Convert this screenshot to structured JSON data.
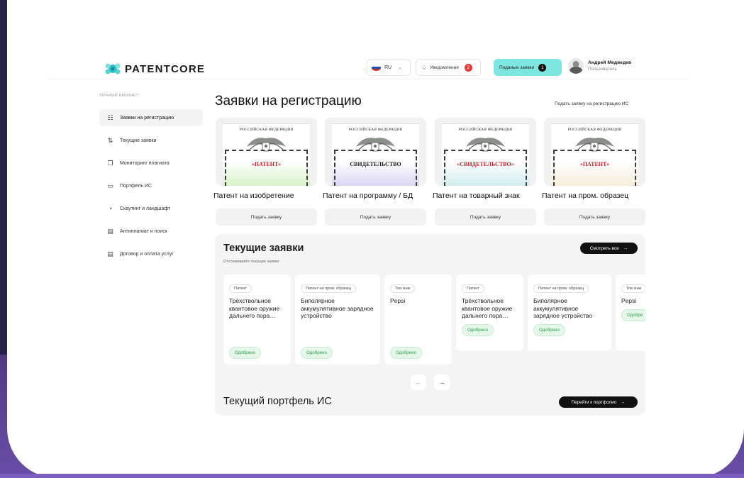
{
  "brand": {
    "name": "PATENTCORE"
  },
  "header": {
    "lang": "RU",
    "notifications_label": "Уведомления",
    "notifications_count": "2",
    "submitted_label": "Поданые заявки",
    "submitted_count": "1",
    "user_name": "Андрей Медведев",
    "user_role": "Пользователь",
    "flag_colors": [
      "#ffffff",
      "#1f4fb8",
      "#d52b1e"
    ]
  },
  "sidebar": {
    "section_title": "ЛИЧНЫЙ КАБИНЕТ",
    "items": [
      {
        "label": "Заявки на регистрацию",
        "icon": "registration-icon",
        "glyph": "☷"
      },
      {
        "label": "Текущие заявки",
        "icon": "flow-icon",
        "glyph": "⇅"
      },
      {
        "label": "Мониторинг плагиата",
        "icon": "copy-icon",
        "glyph": "❐"
      },
      {
        "label": "Портфель ИС",
        "icon": "briefcase-icon",
        "glyph": "▭"
      },
      {
        "label": "Скаутинг и ландшафт",
        "icon": "stopwatch-icon",
        "glyph": "◔"
      },
      {
        "label": "Антиплагиат и поиск",
        "icon": "doc-search-icon",
        "glyph": "▤"
      },
      {
        "label": "Договор и оплата услуг",
        "icon": "contract-icon",
        "glyph": "▤"
      }
    ]
  },
  "main": {
    "title": "Заявки на регистрацию",
    "register_link": "Подать заявку на регистрацию ИС",
    "certificates": [
      {
        "header": "РОССИЙСКАЯ ФЕДЕРАЦИЯ",
        "doc": "«ПАТЕНТ»",
        "label": "Патент на изобретение",
        "button": "Подать заявку",
        "tint": "#d9f2c9",
        "ink": "#c21f2a"
      },
      {
        "header": "РОССИЙСКАЯ ФЕДЕРАЦИЯ",
        "doc": "СВИДЕТЕЛЬСТВО",
        "label": "Патент на программу / БД",
        "button": "Подать заявку",
        "tint": "#dcd6f2",
        "ink": "#1b1b1b"
      },
      {
        "header": "РОССИЙСКАЯ ФЕДЕРАЦИЯ",
        "doc": "«СВИДЕТЕЛЬСТВО»",
        "label": "Патент на товарный знак",
        "button": "Подать заявку",
        "tint": "#d3ecef",
        "ink": "#c21f2a"
      },
      {
        "header": "РОССИЙСКАЯ ФЕДЕРАЦИЯ",
        "doc": "«ПАТЕНТ»",
        "label": "Патент на пром. образец",
        "button": "Подать заявку",
        "tint": "#f6ecd9",
        "ink": "#c21f2a"
      }
    ]
  },
  "current": {
    "title": "Текущие заявки",
    "subtitle": "Отслеживайте текущие заявки",
    "see_all": "Смотреть все",
    "cards": [
      {
        "tag": "Патент",
        "title": "Трёхствольное квантовое оружие дальнего пора…",
        "status": "Одобрено"
      },
      {
        "tag": "Патент на пром. образец",
        "title": "Биполярное аккумулятивное зарядное устройство",
        "status": "Одобрено"
      },
      {
        "tag": "Тов.знак",
        "title": "Pepsi",
        "status": "Одобрено"
      },
      {
        "tag": "Патент",
        "title": "Трёхствольное квантовое оружие дальнего пора…",
        "status": "Одобрено"
      },
      {
        "tag": "Патент на пром. образец",
        "title": "Биполярное аккумулятивное зарядное устройство",
        "status": "Одобрено"
      },
      {
        "tag": "Тов.знак",
        "title": "Pepsi",
        "status": "Одобре"
      }
    ],
    "prev": "←",
    "next": "→"
  },
  "portfolio": {
    "title": "Текущий портфель ИС",
    "button": "Перейти к портфолио"
  }
}
